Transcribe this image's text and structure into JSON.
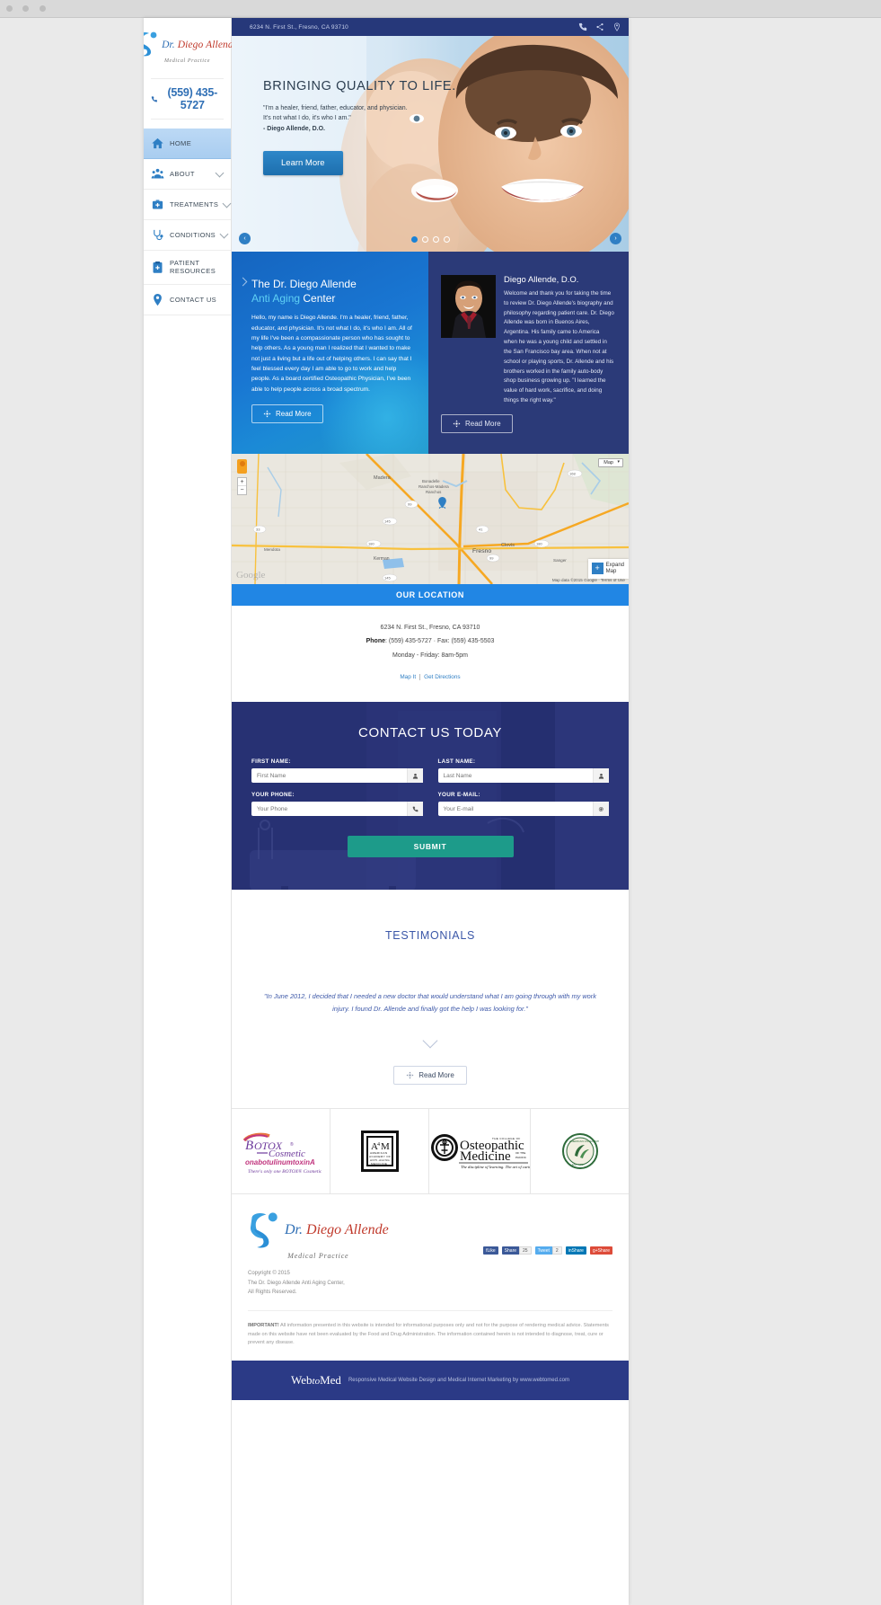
{
  "brand": {
    "name_dr": "Dr. ",
    "name_rest": "Diego Allende",
    "tagline": "Medical Practice",
    "phone": "(559) 435-5727"
  },
  "topbar": {
    "address": "6234 N. First St., Fresno, CA 93710",
    "icons": [
      "phone-icon",
      "share-icon",
      "location-icon"
    ]
  },
  "sidebar": {
    "items": [
      {
        "label": "HOME",
        "icon": "home-icon",
        "active": true,
        "caret": false
      },
      {
        "label": "ABOUT",
        "icon": "people-icon",
        "active": false,
        "caret": true
      },
      {
        "label": "TREATMENTS",
        "icon": "medical-bag-icon",
        "active": false,
        "caret": true
      },
      {
        "label": "CONDITIONS",
        "icon": "stethoscope-icon",
        "active": false,
        "caret": true
      },
      {
        "label": "PATIENT RESOURCES",
        "icon": "clipboard-icon",
        "active": false,
        "caret": false
      },
      {
        "label": "CONTACT US",
        "icon": "map-pin-icon",
        "active": false,
        "caret": false
      }
    ]
  },
  "hero": {
    "headline": "BRINGING QUALITY TO LIFE.",
    "quote_line1": "\"I'm a healer, friend, father, educator, and physician.",
    "quote_line2": "It's not what I do, it's who I am.\"",
    "attribution": "- Diego Allende, D.O.",
    "button": "Learn More",
    "prev": "‹",
    "next": "›",
    "slide_count": 4,
    "active_slide": 1
  },
  "panel_left": {
    "title_line1": "The Dr. Diego Allende",
    "title_highlight": "Anti Aging",
    "title_rest": " Center",
    "body": "Hello, my name is Diego Allende. I'm a healer, friend, father, educator, and physician. It's not what I do, it's who I am. All of my life I've been a compassionate person who has sought to help others. As a young man I realized that I wanted to make not just a living but a life out of helping others. I can say that I feel blessed every day I am able to go to work and help people. As a board certified Osteopathic Physician, I've been able to help people across a broad spectrum.",
    "button": "Read More"
  },
  "panel_right": {
    "name": "Diego Allende, D.O.",
    "body": "Welcome and thank you for taking the time to review Dr. Diego Allende's biography and philosophy regarding patient care. Dr. Diego Allende was born in Buenos Aires, Argentina. His family came to America when he was a young child and settled in the San Francisco bay area. When not at school or playing sports, Dr. Allende and his brothers worked in the family auto-body shop business growing up. \"I learned the value of hard work, sacrifice, and doing things the right way.\"",
    "button": "Read More"
  },
  "map": {
    "type_label": "Map",
    "attribution": "Map data ©2015 Google · Terms of Use",
    "expand_line1": "Expand",
    "expand_line2": "Map",
    "zoom_in": "+",
    "zoom_out": "−",
    "places": [
      "Madera",
      "Bonadelle Ranchos-Madera Ranchos",
      "Clovis",
      "Fresno",
      "Mendota",
      "Kerman",
      "Sanger"
    ],
    "routes": [
      "99",
      "145",
      "41",
      "180",
      "168",
      "33"
    ]
  },
  "location": {
    "bar_title": "OUR LOCATION",
    "address": "6234 N. First St., Fresno, CA 93710",
    "phone_label": "Phone",
    "phone_line": ": (559) 435-5727 · Fax: (559) 435-5503",
    "hours": "Monday - Friday: 8am-5pm",
    "link_map": "Map It",
    "link_directions": "Get Directions"
  },
  "contact_form": {
    "title": "CONTACT US TODAY",
    "fields": [
      {
        "label": "FIRST NAME:",
        "placeholder": "First Name",
        "value": "",
        "icon": "user-icon"
      },
      {
        "label": "LAST NAME:",
        "placeholder": "Last Name",
        "value": "",
        "icon": "user-icon"
      },
      {
        "label": "YOUR PHONE:",
        "placeholder": "Your Phone",
        "value": "",
        "icon": "phone-icon"
      },
      {
        "label": "YOUR E-MAIL:",
        "placeholder": "Your E-mail",
        "value": "",
        "icon": "at-icon"
      }
    ],
    "submit": "SUBMIT"
  },
  "testimonials": {
    "title": "TESTIMONIALS",
    "quote": "\"In June 2012, I decided that I needed a new doctor that would understand what I am going through with my work injury. I found Dr. Allende and finally got the help I was looking for.\"",
    "button": "Read More"
  },
  "affiliations": [
    {
      "name": "botox-cosmetic-logo",
      "title": "BOTOX",
      "sub1": "Cosmetic",
      "sub2": "onabotulinumtoxinA",
      "tag": "There's only one BOTOX® Cosmetic"
    },
    {
      "name": "a4m-logo",
      "title": "A4M",
      "sub1": "AMERICAN ACADEMY OF",
      "sub2": "ANTI-AGING MEDICINE",
      "tag": ""
    },
    {
      "name": "osteopathic-medicine-logo",
      "title": "Osteopathic",
      "sub1": "Medicine",
      "sub2": "THE COLLEGE OF",
      "tag": "The discipline of learning. The art of caring."
    },
    {
      "name": "seal-logo",
      "title": "",
      "sub1": "",
      "sub2": "",
      "tag": ""
    }
  ],
  "social": [
    {
      "name": "facebook-like",
      "label": "Like",
      "count": "",
      "color": "#3b5998"
    },
    {
      "name": "facebook-share",
      "label": "Share",
      "count": "25",
      "color": "#3b5998"
    },
    {
      "name": "twitter-tweet",
      "label": "Tweet",
      "count": "2",
      "color": "#55acee"
    },
    {
      "name": "linkedin-share",
      "label": "Share",
      "count": "",
      "color": "#0077b5"
    },
    {
      "name": "google-plus-share",
      "label": "Share",
      "count": "",
      "color": "#dd4b39"
    }
  ],
  "footer": {
    "copyright_line1": "Copyright © 2015",
    "copyright_line2": "The Dr. Diego Allende Anti Aging Center,",
    "copyright_line3": "All Rights Reserved.",
    "disclaimer_label": "IMPORTANT!",
    "disclaimer": " All information presented in this website is intended for informational purposes only and not for the purpose of rendering medical advice. Statements made on this website have not been evaluated by the Food and Drug Administration. The information contained herein is not intended to diagnose, treat, cure or prevent any disease.",
    "webtomed_web": "Web",
    "webtomed_to": "to",
    "webtomed_med": "Med",
    "webtomed_text": "Responsive Medical Website Design and Medical Internet Marketing by www.webtomed.com"
  },
  "colors": {
    "navy": "#26387a",
    "blue": "#2186e4",
    "teal": "#1d9b8a",
    "accent_light": "#5fd0f5"
  }
}
